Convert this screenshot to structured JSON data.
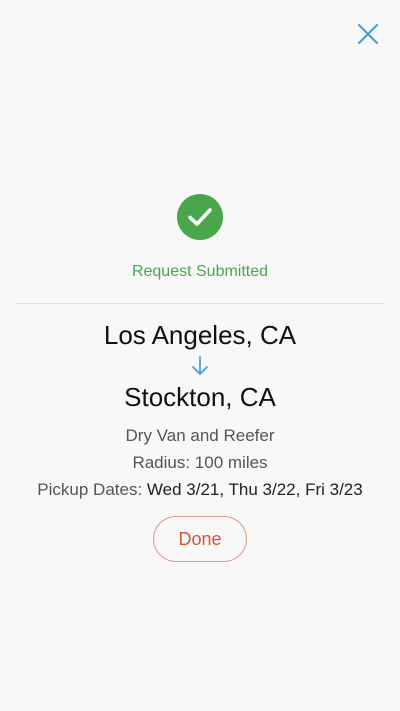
{
  "colors": {
    "success": "#4aa64a",
    "accent_blue": "#4a9fd8",
    "done_red": "#d9533a",
    "done_border": "#e79a8c"
  },
  "header": {
    "close_icon": "close-icon"
  },
  "status": {
    "icon": "check-circle-icon",
    "text": "Request Submitted"
  },
  "route": {
    "origin": "Los Angeles, CA",
    "arrow_icon": "arrow-down-icon",
    "destination": "Stockton, CA"
  },
  "details": {
    "equipment": "Dry Van and Reefer",
    "radius": "Radius: 100 miles",
    "pickup_label": "Pickup Dates:",
    "pickup_dates": "Wed 3/21, Thu 3/22, Fri 3/23"
  },
  "actions": {
    "done_label": "Done"
  }
}
